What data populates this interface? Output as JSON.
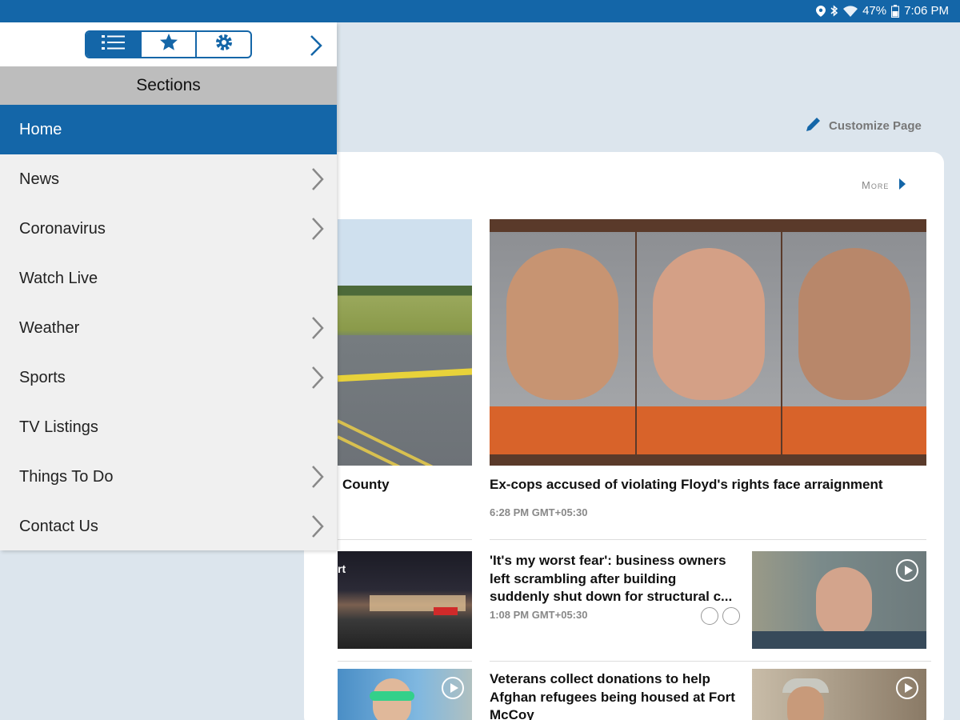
{
  "status_bar": {
    "battery": "47%",
    "time": "7:06 PM",
    "icons": [
      "location-icon",
      "bluetooth-icon",
      "wifi-icon",
      "battery-icon"
    ]
  },
  "header": {
    "customize_label": "Customize Page"
  },
  "section": {
    "more_label": "More"
  },
  "articles": [
    {
      "headline": "County",
      "time": ""
    },
    {
      "headline": "Ex-cops accused of violating Floyd's rights face arraignment",
      "time": "6:28 PM GMT+05:30"
    },
    {
      "headline": "'It's my worst fear': business owners left scrambling after building suddenly shut down for structural c...",
      "time": "1:08 PM GMT+05:30"
    },
    {
      "headline": "Veterans collect donations to help Afghan refugees being housed at Fort McCoy",
      "time": ""
    }
  ],
  "store_logo_text": "rt",
  "drawer": {
    "tabs": [
      "sections-list-icon",
      "favorites-star-icon",
      "settings-gear-icon"
    ],
    "sections_title": "Sections",
    "items": [
      {
        "label": "Home",
        "active": true,
        "has_children": false
      },
      {
        "label": "News",
        "active": false,
        "has_children": true
      },
      {
        "label": "Coronavirus",
        "active": false,
        "has_children": true
      },
      {
        "label": "Watch Live",
        "active": false,
        "has_children": false
      },
      {
        "label": "Weather",
        "active": false,
        "has_children": true
      },
      {
        "label": "Sports",
        "active": false,
        "has_children": true
      },
      {
        "label": "TV Listings",
        "active": false,
        "has_children": false
      },
      {
        "label": "Things To Do",
        "active": false,
        "has_children": true
      },
      {
        "label": "Contact Us",
        "active": false,
        "has_children": true
      }
    ]
  },
  "colors": {
    "brand_blue": "#1466a8",
    "drawer_bg": "#f0f0f0",
    "sections_header_bg": "#bdbdbd",
    "page_bg": "#dce5ed"
  }
}
